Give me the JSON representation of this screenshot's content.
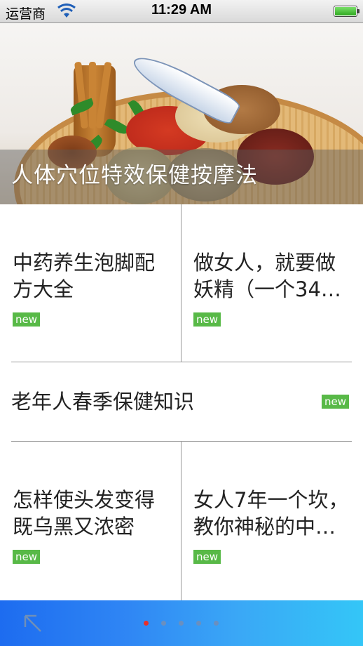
{
  "status_bar": {
    "carrier": "运营商",
    "time": "11:29 AM"
  },
  "banner": {
    "title": "人体穴位特效保健按摩法"
  },
  "articles": [
    {
      "title": "中药养生泡脚配方大全",
      "badge": "new"
    },
    {
      "title": "做女人，就要做妖精（一个34…",
      "badge": "new"
    },
    {
      "title": "老年人春季保健知识",
      "badge": "new"
    },
    {
      "title": "怎样使头发变得既乌黑又浓密",
      "badge": "new"
    },
    {
      "title": "女人7年一个坎，教你神秘的中…",
      "badge": "new"
    }
  ],
  "pager": {
    "count": 5,
    "active_index": 0
  },
  "colors": {
    "badge": "#58b947",
    "bottom_bar_start": "#1d6cf0",
    "bottom_bar_end": "#34c6f7",
    "active_dot": "#e8302a"
  },
  "icons": {
    "wifi": "wifi-icon",
    "battery": "battery-icon",
    "back": "back-arrow-icon"
  }
}
